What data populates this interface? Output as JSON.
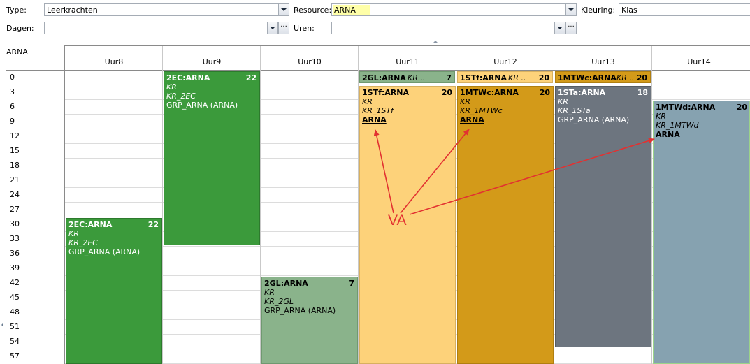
{
  "filters": {
    "type_label": "Type:",
    "type_value": "Leerkrachten",
    "resource_label": "Resource:",
    "resource_value": "ARNA",
    "kleuring_label": "Kleuring:",
    "kleuring_value": "Klas",
    "dagen_label": "Dagen:",
    "dagen_value": "",
    "uren_label": "Uren:",
    "uren_value": "",
    "more_label": "···"
  },
  "grid": {
    "corner_label": "ARNA",
    "columns": [
      "Uur8",
      "Uur9",
      "Uur10",
      "Uur11",
      "Uur12",
      "Uur13",
      "Uur14"
    ],
    "rows": [
      "0",
      "3",
      "6",
      "9",
      "12",
      "15",
      "18",
      "21",
      "24",
      "27",
      "30",
      "33",
      "36",
      "39",
      "42",
      "45",
      "48",
      "51",
      "54",
      "57"
    ]
  },
  "strips": [
    {
      "title": "2GL:ARNA",
      "italic": "KR ..",
      "num": "7",
      "color": "#8ab38b"
    },
    {
      "title": "1STf:ARNA",
      "italic": "KR ..",
      "num": "20",
      "color": "#fdd27a"
    },
    {
      "title": "1MTWc:ARNA",
      "italic": "KR ..",
      "num": "20",
      "color": "#d39a19"
    }
  ],
  "blocks": [
    {
      "title": "2EC:ARNA",
      "num": "22",
      "l1": "KR",
      "l2": "KR_2EC",
      "l3": "GRP_ARNA (ARNA)",
      "color": "#3b9a3b",
      "text_color": "#ffffff"
    },
    {
      "title": "2EC:ARNA",
      "num": "22",
      "l1": "KR",
      "l2": "KR_2EC",
      "l3": "GRP_ARNA (ARNA)",
      "color": "#3b9a3b",
      "text_color": "#ffffff"
    },
    {
      "title": "2GL:ARNA",
      "num": "7",
      "l1": "KR",
      "l2": "KR_2GL",
      "l3": "GRP_ARNA (ARNA)",
      "color": "#8ab38b",
      "text_color": "#000000"
    },
    {
      "title": "1STf:ARNA",
      "num": "20",
      "l1": "KR",
      "l2": "KR_1STf",
      "l3": "ARNA",
      "color": "#fdd27a",
      "text_color": "#000000"
    },
    {
      "title": "1MTWc:ARNA",
      "num": "20",
      "l1": "KR",
      "l2": "KR_1MTWc",
      "l3": "ARNA",
      "color": "#d39a19",
      "text_color": "#000000"
    },
    {
      "title": "1STa:ARNA",
      "num": "18",
      "l1": "KR",
      "l2": "KR_1STa",
      "l3": "GRP_ARNA (ARNA)",
      "color": "#6d757f",
      "text_color": "#ffffff"
    },
    {
      "title": "1MTWd:ARNA",
      "num": "20",
      "l1": "KR",
      "l2": "KR_1MTWd",
      "l3": "ARNA",
      "color": "#86a2b0",
      "text_color": "#000000"
    }
  ],
  "annotation": {
    "text": "VA",
    "color": "#e23131"
  }
}
